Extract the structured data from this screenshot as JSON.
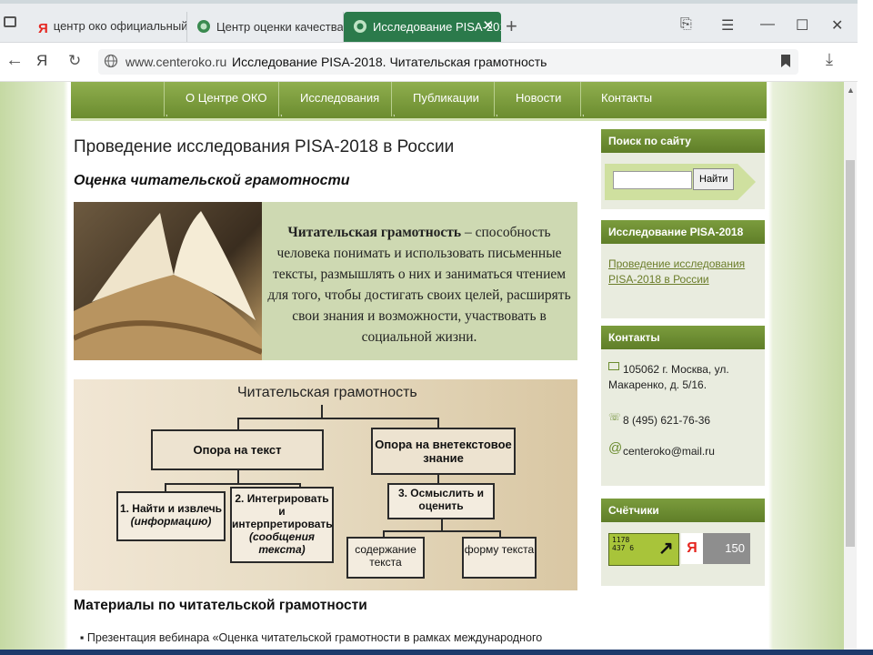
{
  "browser": {
    "tabs": [
      {
        "label": "центр око официальный с",
        "icon": "yandex-icon",
        "active": false
      },
      {
        "label": "Центр оценки качества об",
        "icon": "site-icon",
        "active": false
      },
      {
        "label": "Исследование PISA-201",
        "icon": "site-icon",
        "active": true
      }
    ],
    "url_domain": "www.centeroko.ru",
    "page_title": "Исследование PISA-2018. Читательская грамотность"
  },
  "nav": {
    "items": [
      "О Центре ОКО",
      "Исследования",
      "Публикации",
      "Новости",
      "Контакты"
    ]
  },
  "main": {
    "title": "Проведение исследования PISA-2018 в России",
    "subtitle": "Оценка читательской грамотности",
    "banner": {
      "term": "Читательская грамотность",
      "definition": " – способность человека понимать и использовать письменные тексты, размышлять о них и заниматься чтением для того, чтобы достигать своих целей, расширять свои знания и возможности, участвовать в социальной жизни."
    },
    "diagram": {
      "title": "Читательская грамотность",
      "left_box": "Опора на текст",
      "right_box": "Опора на внетекстовое знание",
      "step1": "1. Найти и извлечь",
      "step1_note": "(информацию)",
      "step2": "2. Интегрировать и интерпретировать",
      "step2_note": "(сообщения текста)",
      "step3": "3. Осмыслить и оценить",
      "content": "содержание текста",
      "form": "форму текста"
    },
    "materials_title": "Материалы по читательской грамотности",
    "materials_item": "Презентация вебинара «Оценка читательской грамотности в рамках международного"
  },
  "sidebar": {
    "search_title": "Поиск по сайту",
    "search_button": "Найти",
    "research_title": "Исследование PISA-2018",
    "research_link": "Проведение исследования PISA-2018 в России",
    "contacts_title": "Контакты",
    "address": "105062 г. Москва, ул. Макаренко, д. 5/16.",
    "phone": "8 (495) 621-76-36",
    "email": "centeroko@mail.ru",
    "counters_title": "Счётчики",
    "counter1": "1178 437 6",
    "counter2_value": "150"
  }
}
